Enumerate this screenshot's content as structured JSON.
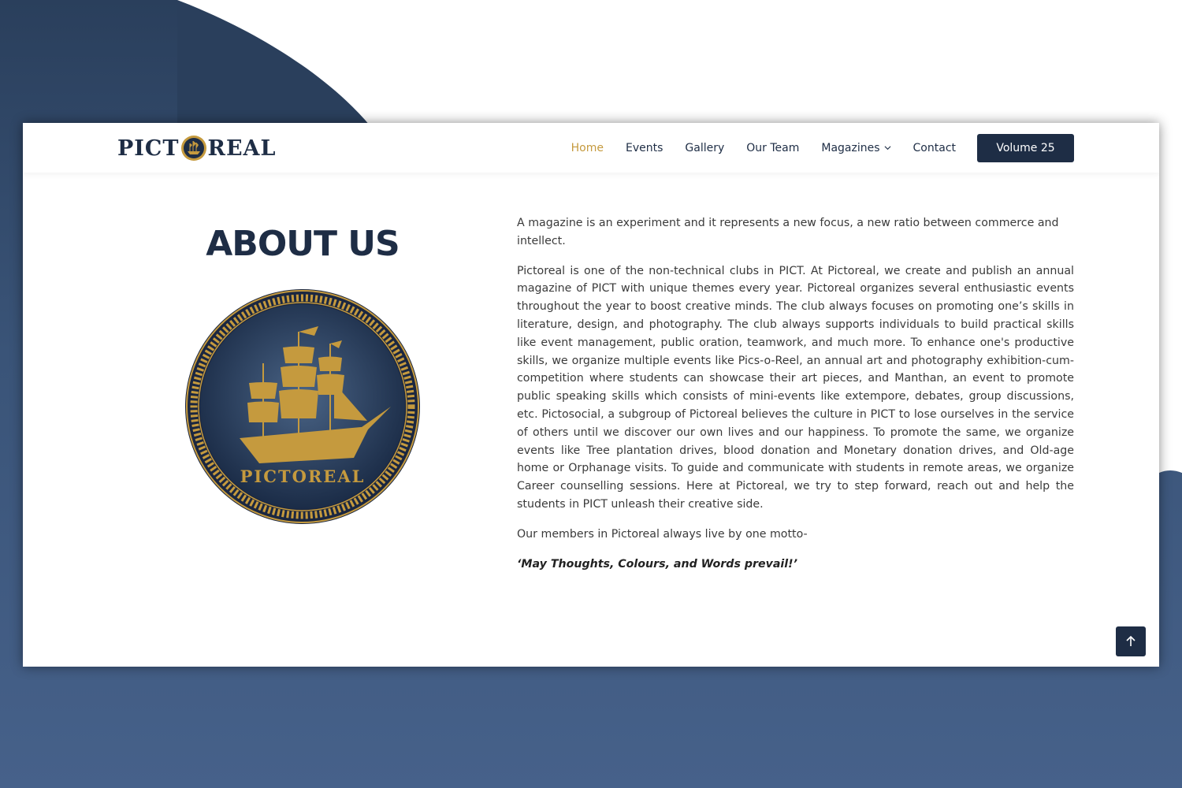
{
  "brand": {
    "logo_left": "PICT",
    "logo_right": "REAL",
    "badge_text": "PICTOREAL"
  },
  "nav": {
    "items": [
      {
        "label": "Home",
        "active": true
      },
      {
        "label": "Events"
      },
      {
        "label": "Gallery"
      },
      {
        "label": "Our Team"
      },
      {
        "label": "Magazines",
        "dropdown": true
      },
      {
        "label": "Contact"
      }
    ],
    "cta": "Volume 25"
  },
  "about": {
    "title": "ABOUT US",
    "paragraphs": [
      "A magazine is an experiment and it represents a new focus, a new ratio between commerce and intellect.",
      "Pictoreal is one of the non-technical clubs in PICT. At Pictoreal, we create and publish an annual magazine of PICT with unique themes every year. Pictoreal organizes several enthusiastic events throughout the year to boost creative minds. The club always focuses on promoting one’s skills in literature, design, and photography. The club always supports individuals to build practical skills like event management, public oration, teamwork, and much more. To enhance one's productive skills, we organize multiple events like Pics-o-Reel, an annual art and photography exhibition-cum-competition where students can showcase their art pieces, and Manthan, an event to promote public speaking skills which consists of mini-events like extempore, debates, group discussions, etc. Pictosocial, a subgroup of Pictoreal believes the culture in PICT to lose ourselves in the service of others until we discover our own lives and our happiness. To promote the same, we organize events like Tree plantation drives, blood donation and Monetary donation drives, and Old-age home or Orphanage visits. To guide and communicate with students in remote areas, we organize Career counselling sessions. Here at Pictoreal, we try to step forward, reach out and help the students in PICT unleash their creative side.",
      "Our members in Pictoreal always live by one motto-"
    ],
    "motto": "‘May Thoughts, Colours, and Words prevail!’"
  },
  "colors": {
    "navy": "#1e2d45",
    "gold": "#c59a3e",
    "background": "#3a5478"
  },
  "icons": {
    "scroll_top": "arrow-up-icon",
    "dropdown": "chevron-down-icon"
  }
}
